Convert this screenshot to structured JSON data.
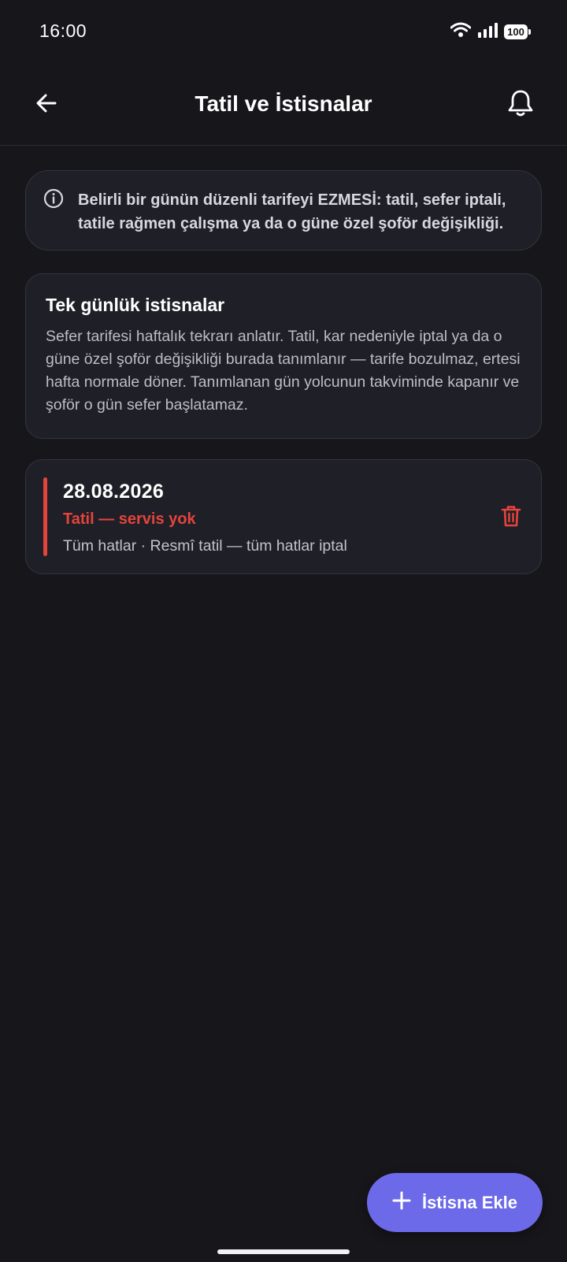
{
  "status_bar": {
    "time": "16:00",
    "battery": "100"
  },
  "header": {
    "title": "Tatil ve İstisnalar"
  },
  "info_banner": {
    "text": "Belirli bir günün düzenli tarifeyi EZMESİ: tatil, sefer iptali, tatile rağmen çalışma ya da o güne özel şoför değişikliği."
  },
  "description_card": {
    "title": "Tek günlük istisnalar",
    "body": "Sefer tarifesi haftalık tekrarı anlatır. Tatil, kar nedeniyle iptal ya da o güne özel şoför değişikliği burada tanımlanır — tarife bozulmaz, ertesi hafta normale döner. Tanımlanan gün yolcunun takviminde kapanır ve şoför o gün sefer başlatamaz."
  },
  "exceptions": [
    {
      "date": "28.08.2026",
      "type": "Tatil — servis yok",
      "detail": "Tüm hatlar · Resmî tatil — tüm hatlar iptal"
    }
  ],
  "fab": {
    "label": "İstisna Ekle"
  },
  "colors": {
    "background": "#16161b",
    "card": "#1f1f27",
    "accent": "#6c6ae8",
    "danger": "#e5443b"
  }
}
